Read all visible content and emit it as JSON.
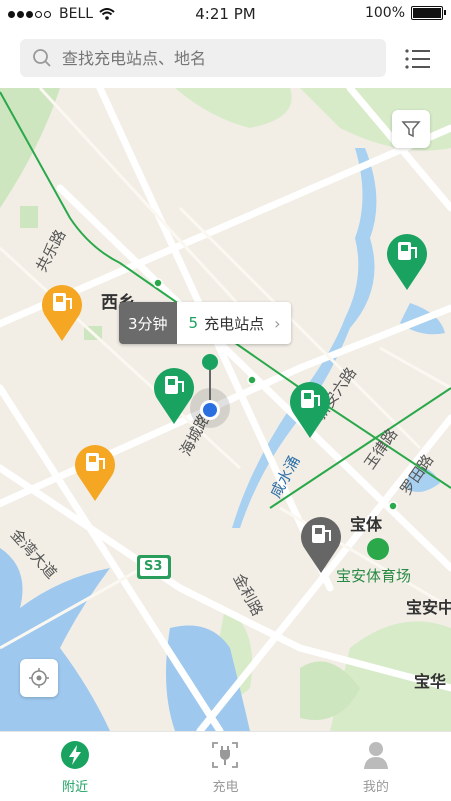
{
  "status_bar": {
    "carrier": "BELL",
    "time": "4:21 PM",
    "battery": "100%"
  },
  "search": {
    "placeholder": "查找充电站点、地名"
  },
  "map": {
    "labels": {
      "gongle_road": "共乐路",
      "xixiang": "西乡",
      "haicheng_road": "海城路",
      "xianshui_chong": "咸水涌",
      "xinan_6_road": "新安六路",
      "yulv_road": "玉律路",
      "luotian_road": "罗田路",
      "baoti": "宝体",
      "baoan_stadium": "宝安体育场",
      "jinwan_avenue": "金湾大道",
      "jinli_road": "金利路",
      "s3": "S3",
      "baoan_center": "宝安中",
      "baohua": "宝华"
    },
    "callout": {
      "duration": "3分钟",
      "count": "5",
      "stations_label": "充电站点"
    }
  },
  "tabs": [
    {
      "label": "附近",
      "icon": "lightning-icon",
      "active": true
    },
    {
      "label": "充电",
      "icon": "plug-icon",
      "active": false
    },
    {
      "label": "我的",
      "icon": "person-icon",
      "active": false
    }
  ],
  "colors": {
    "accent": "#1aa260",
    "pin_green": "#1aa260",
    "pin_orange": "#f5a623",
    "pin_gray": "#666666"
  }
}
